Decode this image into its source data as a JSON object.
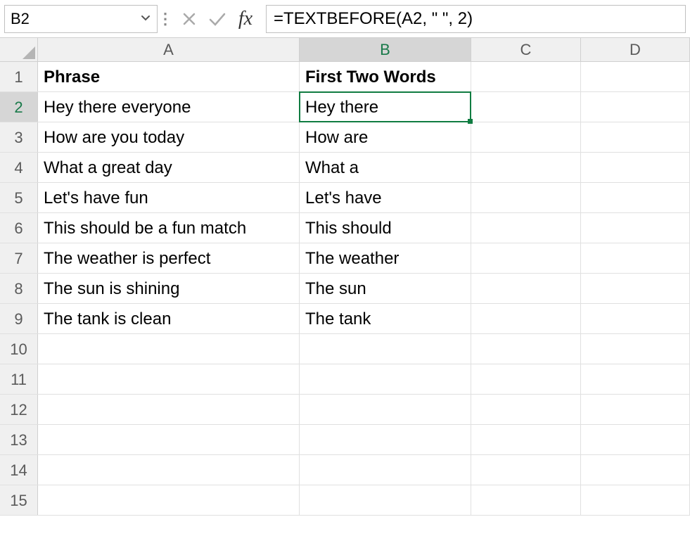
{
  "formula_bar": {
    "name_box": "B2",
    "formula": "=TEXTBEFORE(A2, \" \", 2)"
  },
  "columns": [
    "A",
    "B",
    "C",
    "D"
  ],
  "selected_column_index": 1,
  "selected_row_index": 1,
  "rows": [
    {
      "num": "1",
      "cells": [
        "Phrase",
        "First Two Words",
        "",
        ""
      ],
      "bold": true
    },
    {
      "num": "2",
      "cells": [
        "Hey there everyone",
        "Hey there",
        "",
        ""
      ],
      "active_col": 1
    },
    {
      "num": "3",
      "cells": [
        "How are you today",
        "How are",
        "",
        ""
      ]
    },
    {
      "num": "4",
      "cells": [
        "What a great day",
        "What a",
        "",
        ""
      ]
    },
    {
      "num": "5",
      "cells": [
        "Let's have fun",
        "Let's have",
        "",
        ""
      ]
    },
    {
      "num": "6",
      "cells": [
        "This should be a fun match",
        "This should",
        "",
        ""
      ]
    },
    {
      "num": "7",
      "cells": [
        "The weather is perfect",
        "The weather",
        "",
        ""
      ]
    },
    {
      "num": "8",
      "cells": [
        "The sun is shining",
        "The sun",
        "",
        ""
      ]
    },
    {
      "num": "9",
      "cells": [
        "The tank is clean",
        "The tank",
        "",
        ""
      ]
    },
    {
      "num": "10",
      "cells": [
        "",
        "",
        "",
        ""
      ]
    },
    {
      "num": "11",
      "cells": [
        "",
        "",
        "",
        ""
      ]
    },
    {
      "num": "12",
      "cells": [
        "",
        "",
        "",
        ""
      ]
    },
    {
      "num": "13",
      "cells": [
        "",
        "",
        "",
        ""
      ]
    },
    {
      "num": "14",
      "cells": [
        "",
        "",
        "",
        ""
      ]
    },
    {
      "num": "15",
      "cells": [
        "",
        "",
        "",
        ""
      ]
    }
  ]
}
